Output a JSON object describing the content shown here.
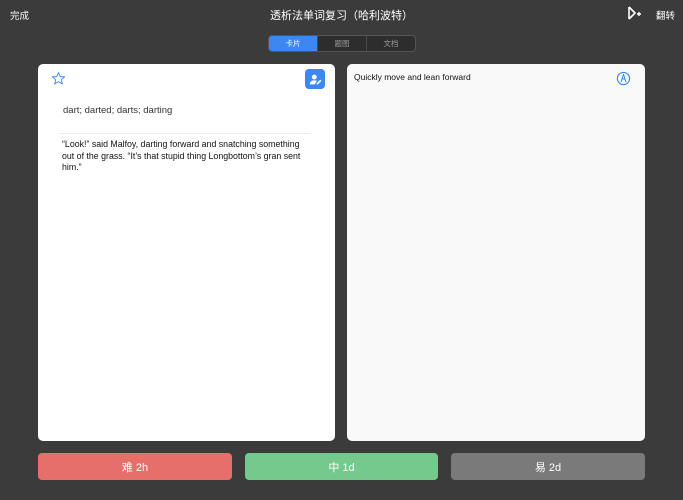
{
  "topbar": {
    "done_label": "完成",
    "title": "透析法单词复习（哈利波特）",
    "flip_label": "翻转",
    "reader_icon": "reader-add-icon"
  },
  "segments": {
    "items": [
      {
        "label": "卡片",
        "active": true
      },
      {
        "label": "题图",
        "active": false
      },
      {
        "label": "文档",
        "active": false
      }
    ]
  },
  "front_card": {
    "star_icon": "star-outline-icon",
    "edit_icon": "person-edit-icon",
    "word_forms": "dart; darted; darts; darting",
    "sentence": "“Look!” said Malfoy, darting forward and snatching something out of the grass. “It’s that stupid thing Longbottom’s gran sent him.”"
  },
  "back_card": {
    "definition": "Quickly move and lean forward",
    "speak_icon": "pen-circle-icon"
  },
  "review_buttons": {
    "hard": "难 2h",
    "medium": "中 1d",
    "easy": "易 2d"
  },
  "colors": {
    "background": "#3b3b3b",
    "accent": "#3d87f2",
    "hard": "#e66f6a",
    "medium": "#76c98c",
    "easy": "#7a7a7a"
  }
}
